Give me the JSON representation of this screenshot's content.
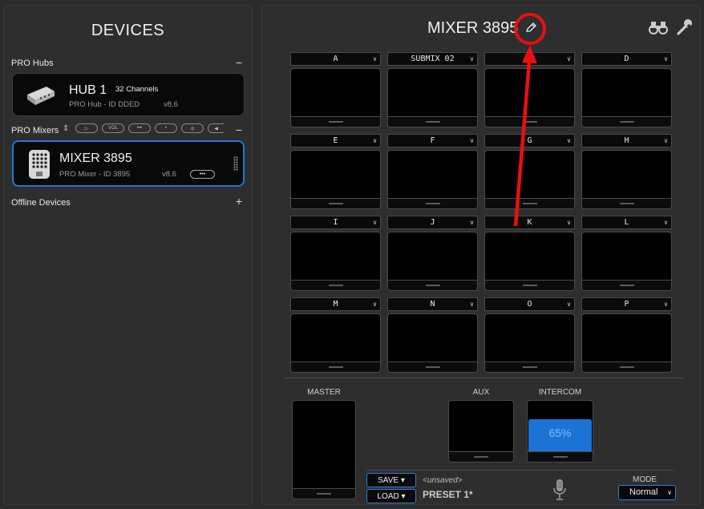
{
  "left_panel": {
    "title": "DEVICES",
    "hubs_section": {
      "label": "PRO Hubs",
      "control": "−"
    },
    "hub": {
      "name": "HUB 1",
      "channels": "32 Channels",
      "subtitle": "PRO Hub - ID DDED",
      "version": "v8.6"
    },
    "mixers_section": {
      "label": "PRO Mixers",
      "sort_glyph": "⇕",
      "control": "−",
      "filters": [
        "▷",
        "VOL",
        "•••",
        "•",
        "◎",
        "◀"
      ]
    },
    "mixer": {
      "name": "MIXER 3895",
      "subtitle": "PRO Mixer - ID 3895",
      "version": "v8.6",
      "more": "•••"
    },
    "offline_section": {
      "label": "Offline Devices",
      "control": "+"
    }
  },
  "right_panel": {
    "title": "MIXER 3895",
    "icons": [
      "pencil-icon",
      "binoculars-icon",
      "wrench-icon"
    ],
    "channels": [
      [
        "A",
        "SUBMIX 02",
        "",
        "D"
      ],
      [
        "E",
        "F",
        "G",
        "H"
      ],
      [
        "I",
        "J",
        "K",
        "L"
      ],
      [
        "M",
        "N",
        "O",
        "P"
      ]
    ],
    "buses": {
      "master": "MASTER",
      "aux": "AUX",
      "intercom": "INTERCOM",
      "intercom_level": "65%",
      "intercom_level_value": 65
    },
    "save": "SAVE ▾",
    "load": "LOAD ▾",
    "unsaved": "<unsaved>",
    "preset": "PRESET 1*",
    "mode_label": "MODE",
    "mode_value": "Normal"
  },
  "colors": {
    "accent": "#1e78d8",
    "annotation": "#e81010",
    "intercom_fill": "#1c73d6"
  }
}
